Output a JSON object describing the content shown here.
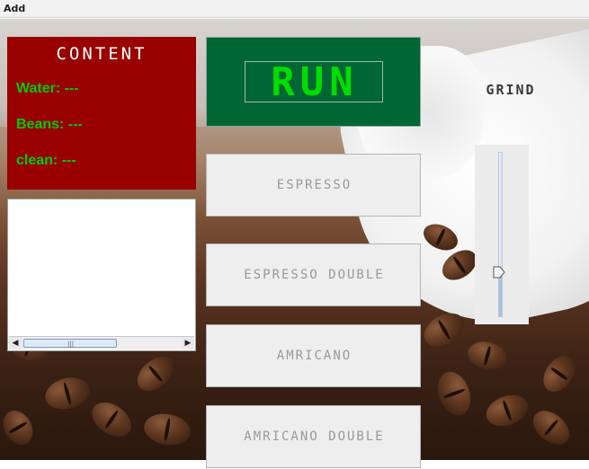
{
  "window": {
    "title": "Add"
  },
  "content_panel": {
    "heading": "CONTENT",
    "water": "Water: ---",
    "beans": "Beans: ---",
    "clean": "clean: ---"
  },
  "log": {
    "text": ""
  },
  "run_button": {
    "label": "RUN"
  },
  "drinks": [
    {
      "label": "ESPRESSO"
    },
    {
      "label": "ESPRESSO DOUBLE"
    },
    {
      "label": "AMRICANO"
    },
    {
      "label": "AMRICANO DOUBLE"
    }
  ],
  "grind": {
    "label": "GRIND",
    "value_fraction": 0.27
  },
  "colors": {
    "content_bg": "#990000",
    "content_text": "#00cc00",
    "run_bg": "#006633",
    "run_text": "#00dd00"
  }
}
